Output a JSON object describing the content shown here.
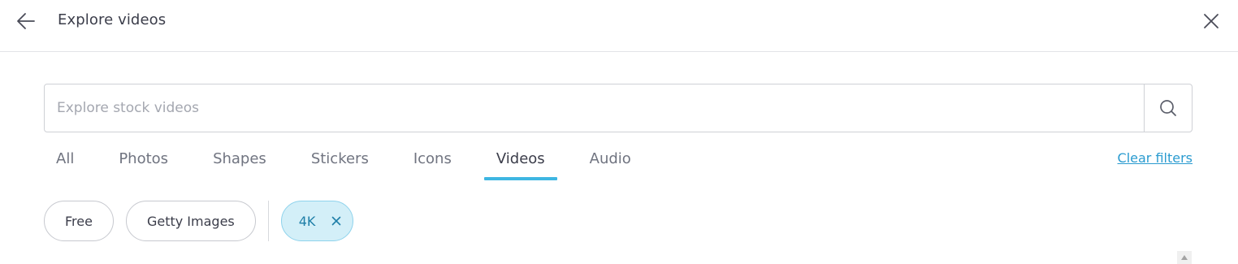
{
  "header": {
    "title": "Explore videos",
    "back_icon": "arrow-left-icon",
    "close_icon": "close-icon"
  },
  "search": {
    "placeholder": "Explore stock videos",
    "value": "",
    "icon": "search-icon"
  },
  "tabs": [
    {
      "label": "All",
      "active": false
    },
    {
      "label": "Photos",
      "active": false
    },
    {
      "label": "Shapes",
      "active": false
    },
    {
      "label": "Stickers",
      "active": false
    },
    {
      "label": "Icons",
      "active": false
    },
    {
      "label": "Videos",
      "active": true
    },
    {
      "label": "Audio",
      "active": false
    }
  ],
  "clear_filters_label": "Clear filters",
  "chips": {
    "free": "Free",
    "getty": "Getty Images",
    "active_4k": "4K"
  },
  "colors": {
    "accent": "#3eb6e2",
    "link": "#2a9bd0",
    "active_chip_bg": "#d3eff8",
    "active_chip_text": "#1f7fa8"
  }
}
